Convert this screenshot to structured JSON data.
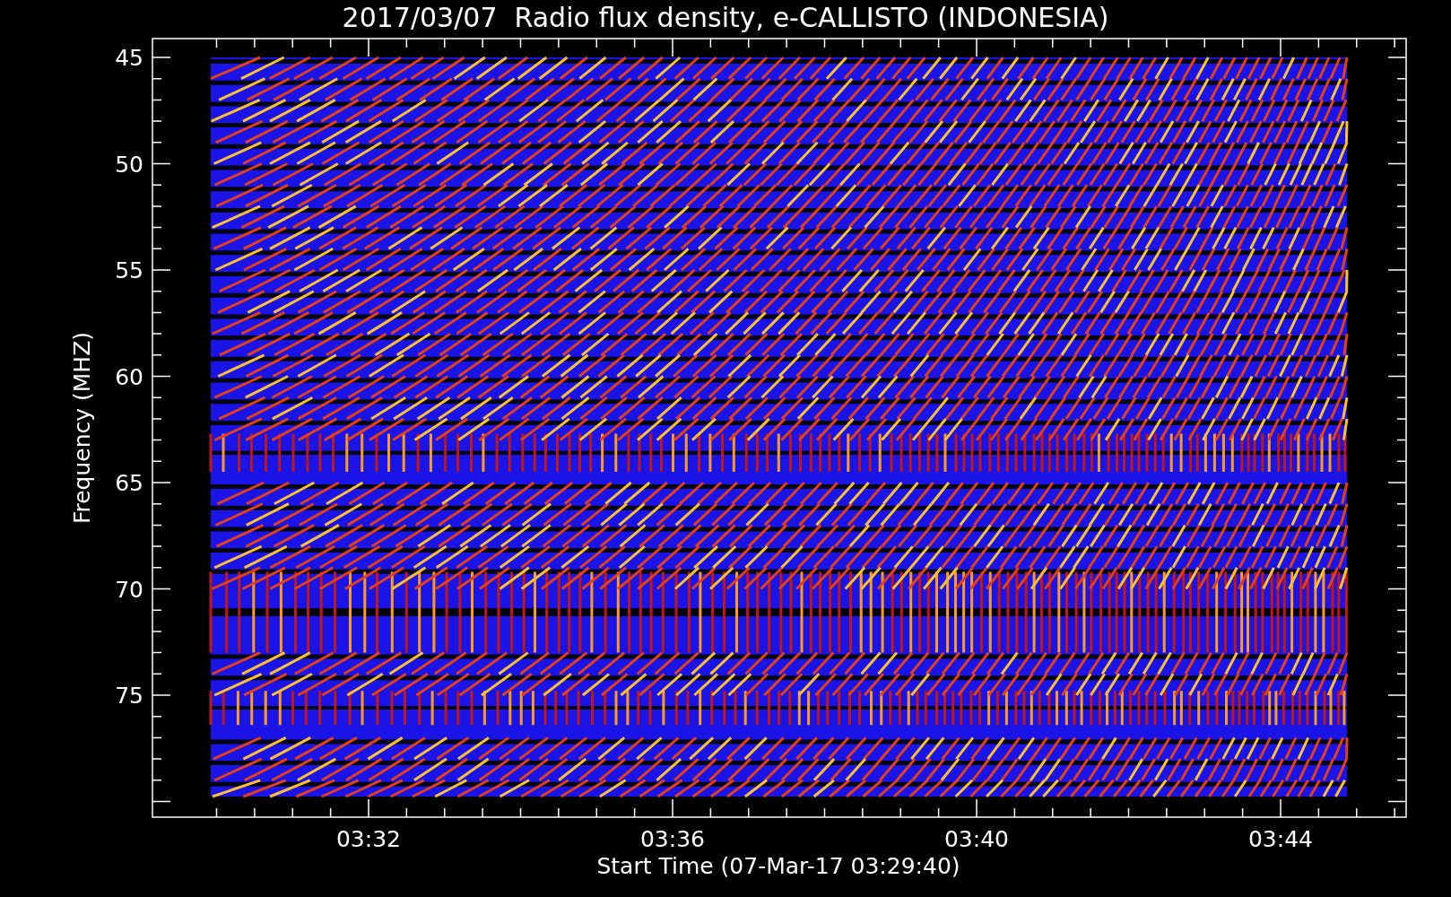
{
  "title": "2017/03/07  Radio flux density, e-CALLISTO (INDONESIA)",
  "y_axis": {
    "label": "Frequency (MHZ)",
    "ticks": [
      "45",
      "50",
      "55",
      "60",
      "65",
      "70",
      "75"
    ]
  },
  "x_axis": {
    "label": "Start Time (07-Mar-17 03:29:40)",
    "ticks": [
      "03:32",
      "03:36",
      "03:40",
      "03:44"
    ]
  }
}
